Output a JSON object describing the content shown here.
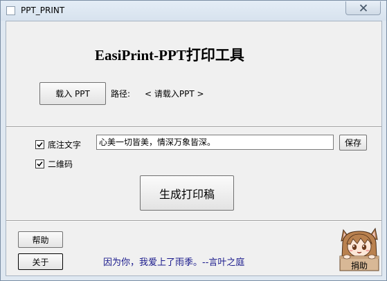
{
  "window": {
    "title": "PPT_PRINT"
  },
  "header": {
    "title": "EasiPrint-PPT打印工具"
  },
  "load": {
    "button_label": "载入 PPT",
    "path_label": "路径:",
    "path_value": "< 请载入PPT >"
  },
  "options": {
    "footnote_label": "底注文字",
    "footnote_checked": true,
    "footnote_text": "心美一切皆美，情深万象皆深。",
    "save_label": "保存",
    "qrcode_label": "二维码",
    "qrcode_checked": true
  },
  "generate": {
    "button_label": "生成打印稿"
  },
  "footer": {
    "help_label": "帮助",
    "about_label": "关于",
    "quote": "因为你，我爱上了雨季。--言叶之庭",
    "donate_label": "捐助"
  },
  "colors": {
    "quote_text": "#1a1a8c",
    "title_bar": "#dfe8f1",
    "client_bg": "#f0f0f0"
  },
  "icons": {
    "close": "close-icon",
    "check": "checkmark-icon",
    "donate": "donate-mascot-icon"
  }
}
